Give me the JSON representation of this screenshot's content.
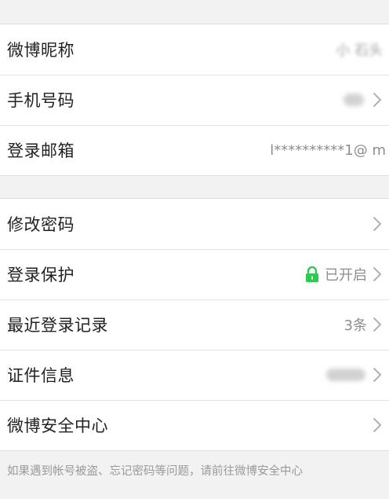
{
  "account": {
    "rows": [
      {
        "label": "微博昵称",
        "value": "小 石头"
      },
      {
        "label": "手机号码",
        "value": ""
      },
      {
        "label": "登录邮箱",
        "value": "l**********1@ m"
      }
    ]
  },
  "security": {
    "rows": [
      {
        "label": "修改密码",
        "value": ""
      },
      {
        "label": "登录保护",
        "value": "已开启",
        "icon": "lock-icon",
        "icon_color": "#2ec94f"
      },
      {
        "label": "最近登录记录",
        "value": "3条"
      },
      {
        "label": "证件信息",
        "value": ""
      },
      {
        "label": "微博安全中心",
        "value": ""
      }
    ]
  },
  "footer": {
    "text": "如果遇到帐号被盗、忘记密码等问题，请前往微博安全中心"
  },
  "colors": {
    "background": "#f2f2f2",
    "label": "#222222",
    "value": "#8e8e8e",
    "accent_lock": "#2ec94f"
  }
}
